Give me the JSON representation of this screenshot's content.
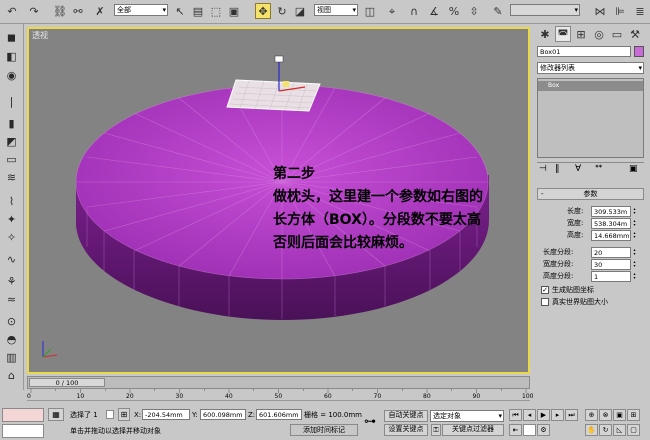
{
  "toolbar": {
    "selection_filter": "全部",
    "reference_coord": "视图"
  },
  "viewport": {
    "label": "透视",
    "annotation_lines": [
      "第二步",
      "做枕头，这里建一个参数如右图的",
      "长方体（BOX）。分段数不要太高",
      "否则后面会比较麻烦。"
    ]
  },
  "command_panel": {
    "object_name": "Box01",
    "modifier_list": "修改器列表",
    "stack_item": "Box",
    "rollout_title": "参数",
    "length_label": "长度:",
    "length_value": "309.533m",
    "width_label": "宽度:",
    "width_value": "538.304m",
    "height_label": "高度:",
    "height_value": "14.668mm",
    "length_segs_label": "长度分段:",
    "length_segs_value": "20",
    "width_segs_label": "宽度分段:",
    "width_segs_value": "30",
    "height_segs_label": "高度分段:",
    "height_segs_value": "1",
    "gen_mapping_label": "生成贴图坐标",
    "real_world_label": "真实世界贴图大小"
  },
  "timeline": {
    "frame_display": "0 / 100",
    "ticks": [
      "0",
      "10",
      "20",
      "30",
      "40",
      "50",
      "60",
      "70",
      "80",
      "90",
      "100"
    ]
  },
  "status": {
    "selected_text": "选择了 1",
    "x_label": "X:",
    "x_value": "-204.54mm",
    "y_label": "Y:",
    "y_value": "600.098mm",
    "z_label": "Z:",
    "z_value": "601.606mm",
    "grid_text": "栅格 = 100.0mm",
    "autokey_label": "自动关键点",
    "selected_obj_dropdown": "选定对象",
    "setkey_label": "设置关键点",
    "keyfilter_label": "关键点过滤器",
    "prompt_text": "单击并拖动以选择并移动对象",
    "addtime_label": "添加时间标记"
  }
}
